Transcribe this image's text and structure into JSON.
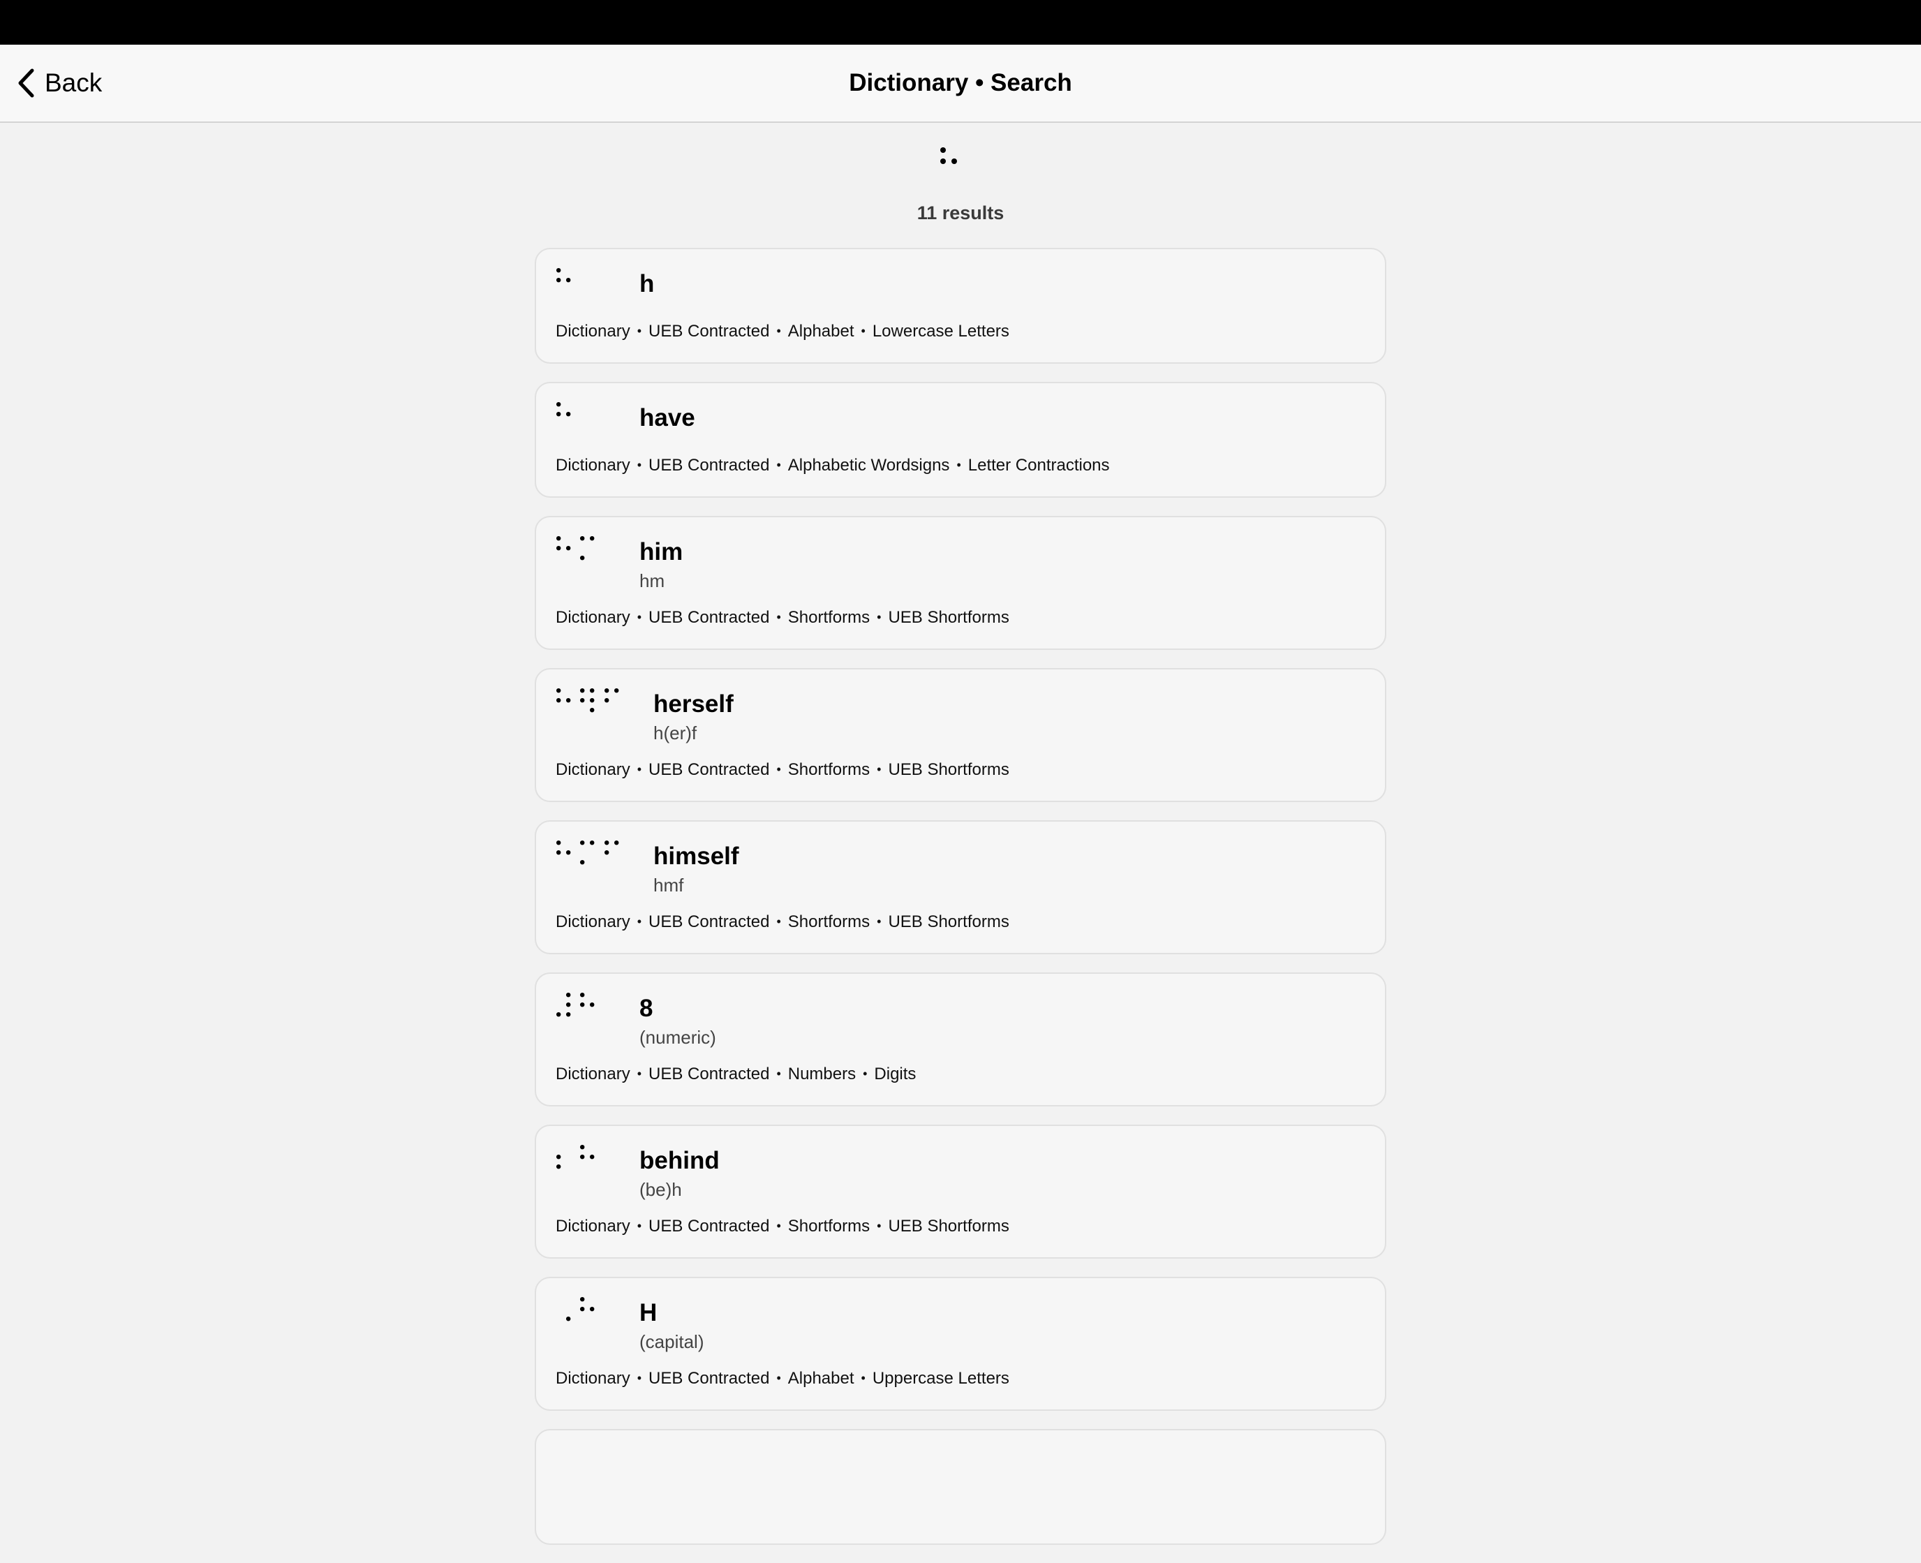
{
  "nav": {
    "back_label": "Back",
    "title": "Dictionary • Search"
  },
  "search": {
    "query_cells": [
      [
        1,
        2,
        5
      ]
    ],
    "result_count": "11 results"
  },
  "icons": {
    "back": "chevron-left-icon"
  },
  "results": [
    {
      "word": "h",
      "sub": "",
      "cells": [
        [
          1,
          2,
          5
        ]
      ],
      "path": [
        "Dictionary",
        "UEB Contracted",
        "Alphabet",
        "Lowercase Letters"
      ]
    },
    {
      "word": "have",
      "sub": "",
      "cells": [
        [
          1,
          2,
          5
        ]
      ],
      "path": [
        "Dictionary",
        "UEB Contracted",
        "Alphabetic Wordsigns",
        "Letter Contractions"
      ]
    },
    {
      "word": "him",
      "sub": "hm",
      "cells": [
        [
          1,
          2,
          5
        ],
        [
          1,
          3,
          4
        ]
      ],
      "path": [
        "Dictionary",
        "UEB Contracted",
        "Shortforms",
        "UEB Shortforms"
      ]
    },
    {
      "word": "herself",
      "sub": "h(er)f",
      "cells": [
        [
          1,
          2,
          5
        ],
        [
          1,
          2,
          4,
          5,
          6
        ],
        [
          1,
          2,
          4
        ]
      ],
      "path": [
        "Dictionary",
        "UEB Contracted",
        "Shortforms",
        "UEB Shortforms"
      ]
    },
    {
      "word": "himself",
      "sub": "hmf",
      "cells": [
        [
          1,
          2,
          5
        ],
        [
          1,
          3,
          4
        ],
        [
          1,
          2,
          4
        ]
      ],
      "path": [
        "Dictionary",
        "UEB Contracted",
        "Shortforms",
        "UEB Shortforms"
      ]
    },
    {
      "word": "8",
      "sub": "(numeric)",
      "cells": [
        [
          3,
          4,
          5,
          6
        ],
        [
          1,
          2,
          5
        ]
      ],
      "path": [
        "Dictionary",
        "UEB Contracted",
        "Numbers",
        "Digits"
      ]
    },
    {
      "word": "behind",
      "sub": "(be)h",
      "cells": [
        [
          2,
          3
        ],
        [
          1,
          2,
          5
        ]
      ],
      "path": [
        "Dictionary",
        "UEB Contracted",
        "Shortforms",
        "UEB Shortforms"
      ]
    },
    {
      "word": "H",
      "sub": "(capital)",
      "cells": [
        [
          6
        ],
        [
          1,
          2,
          5
        ]
      ],
      "path": [
        "Dictionary",
        "UEB Contracted",
        "Alphabet",
        "Uppercase Letters"
      ]
    },
    {
      "word": "",
      "sub": "",
      "cells": [],
      "path": []
    }
  ]
}
